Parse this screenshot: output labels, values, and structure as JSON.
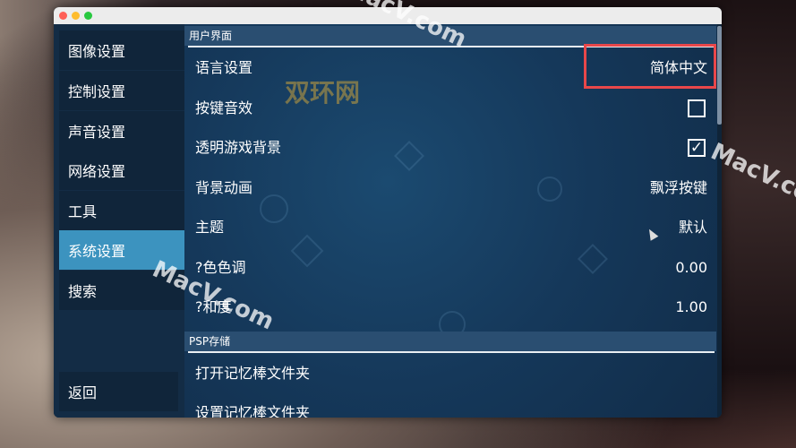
{
  "sidebar": {
    "items": [
      {
        "label": "图像设置"
      },
      {
        "label": "控制设置"
      },
      {
        "label": "声音设置"
      },
      {
        "label": "网络设置"
      },
      {
        "label": "工具"
      },
      {
        "label": "系统设置"
      },
      {
        "label": "搜索"
      }
    ],
    "back_label": "返回"
  },
  "panel": {
    "section_ui": "用户界面",
    "rows": [
      {
        "label": "语言设置",
        "value": "简体中文"
      },
      {
        "label": "按键音效",
        "checked": false
      },
      {
        "label": "透明游戏背景",
        "checked": true
      },
      {
        "label": "背景动画",
        "value": "飘浮按键"
      },
      {
        "label": "主题",
        "value": "默认"
      },
      {
        "label": "?色色调",
        "value": "0.00"
      },
      {
        "label": "?和度",
        "value": "1.00"
      }
    ],
    "section_psp": "PSP存储",
    "psp_rows": [
      {
        "label": "打开记忆棒文件夹"
      },
      {
        "label": "设置记忆棒文件夹"
      }
    ],
    "checkmark_glyph": "✓"
  },
  "watermarks": {
    "mac1": "MacV.com",
    "mac2": "MacV.co",
    "mac3": "MacV.com",
    "cn": "双环网"
  },
  "colors": {
    "active_nav": "#3c93bf",
    "highlight_border": "#e8474a",
    "panel_bg": "#14334e"
  }
}
